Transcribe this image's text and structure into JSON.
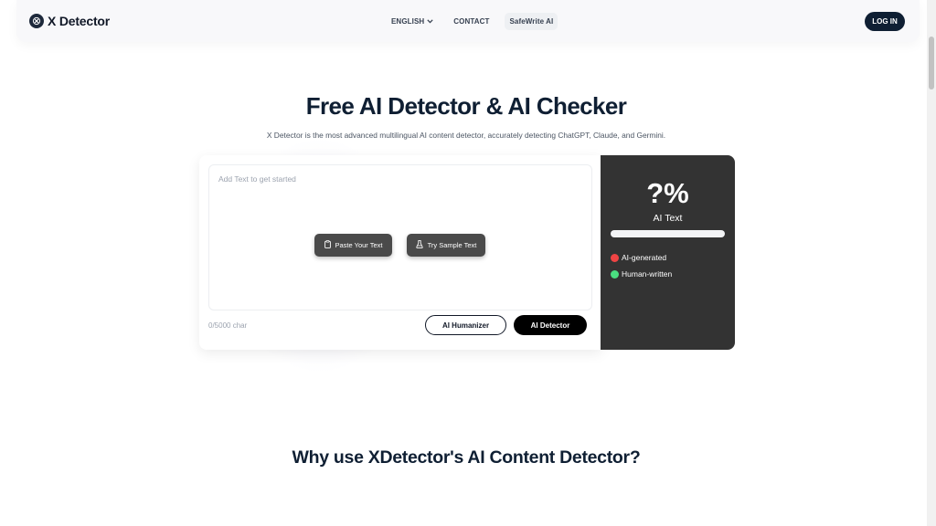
{
  "header": {
    "brand": "X Detector",
    "nav": [
      {
        "label": "ENGLISH",
        "has_dropdown": true
      },
      {
        "label": "CONTACT",
        "has_dropdown": false
      },
      {
        "label": "SafeWrite AI",
        "has_dropdown": false
      }
    ],
    "login_label": "LOG IN"
  },
  "hero": {
    "title": "Free AI Detector & AI Checker",
    "subtitle": "X Detector is the most advanced multilingual AI content detector, accurately detecting ChatGPT, Claude, and Germini."
  },
  "editor": {
    "placeholder": "Add Text to get started",
    "paste_label": "Paste Your Text",
    "sample_label": "Try Sample Text",
    "char_count": "0/5000 char",
    "humanizer_label": "AI Humanizer",
    "detector_label": "AI Detector"
  },
  "result": {
    "percent": "?%",
    "label": "AI Text",
    "ai_fraction": 0,
    "legend": [
      {
        "label": "AI-generated",
        "color": "#ef4444"
      },
      {
        "label": "Human-written",
        "color": "#4ade80"
      }
    ]
  },
  "section": {
    "title": "Why use XDetector's AI Content Detector?"
  },
  "colors": {
    "brand_dark": "#0f1f33",
    "result_bg": "#333333",
    "ai_red": "#ef4444",
    "human_green": "#4ade80"
  }
}
